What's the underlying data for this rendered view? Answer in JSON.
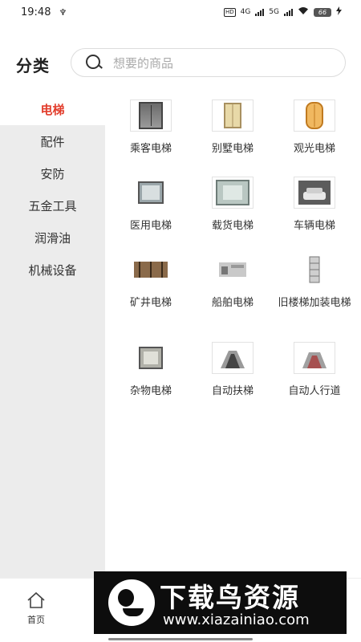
{
  "status_bar": {
    "time": "19:48",
    "usb_symbol": "♆",
    "hd_label": "HD",
    "net1": "4G",
    "net2": "5G",
    "battery": "66"
  },
  "header": {
    "title": "分类",
    "search_placeholder": "想要的商品"
  },
  "sidebar": {
    "items": [
      {
        "label": "电梯",
        "active": true
      },
      {
        "label": "配件"
      },
      {
        "label": "安防"
      },
      {
        "label": "五金工具"
      },
      {
        "label": "润滑油"
      },
      {
        "label": "机械设备"
      }
    ]
  },
  "grid": {
    "items": [
      {
        "label": "乘客电梯",
        "icon": "passenger-elevator-icon"
      },
      {
        "label": "别墅电梯",
        "icon": "villa-elevator-icon"
      },
      {
        "label": "观光电梯",
        "icon": "sightseeing-elevator-icon"
      },
      {
        "label": "医用电梯",
        "icon": "medical-elevator-icon"
      },
      {
        "label": "载货电梯",
        "icon": "freight-elevator-icon"
      },
      {
        "label": "车辆电梯",
        "icon": "vehicle-elevator-icon"
      },
      {
        "label": "矿井电梯",
        "icon": "mine-elevator-icon"
      },
      {
        "label": "船舶电梯",
        "icon": "ship-elevator-icon"
      },
      {
        "label": "旧楼梯加装电梯",
        "icon": "retrofit-elevator-icon"
      },
      {
        "label": "杂物电梯",
        "icon": "dumbwaiter-icon"
      },
      {
        "label": "自动扶梯",
        "icon": "escalator-icon"
      },
      {
        "label": "自动人行道",
        "icon": "moving-walkway-icon"
      }
    ]
  },
  "bottom_nav": {
    "home_label": "首页"
  },
  "watermark": {
    "title": "下载鸟资源",
    "url": "www.xiazainiao.com"
  },
  "colors": {
    "accent": "#e23d2c",
    "sidebar_bg": "#ececec"
  }
}
